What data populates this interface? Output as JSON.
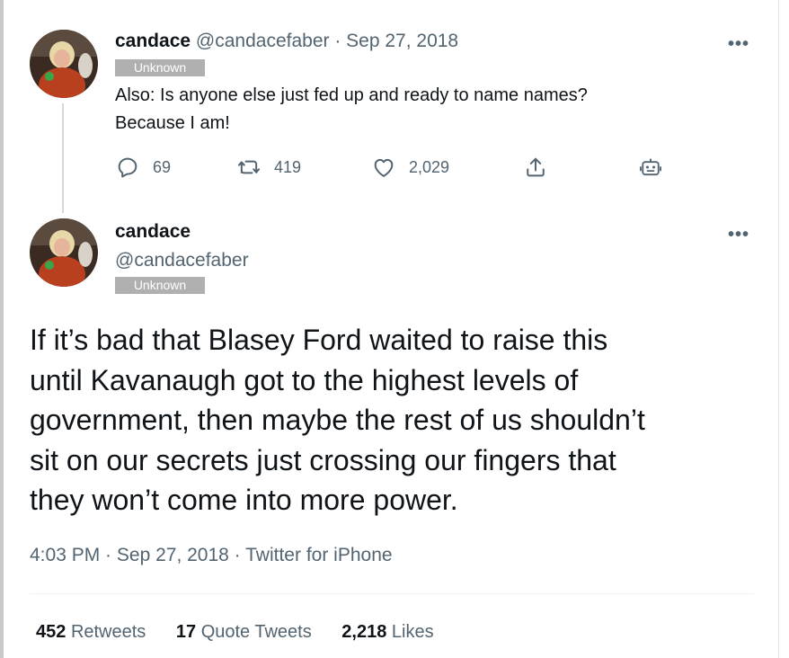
{
  "tweet1": {
    "name": "candace",
    "handle": "@candacefaber",
    "separator": " · ",
    "date": "Sep 27, 2018",
    "badge": "Unknown",
    "text_line1": "Also: Is anyone else just fed up and ready to name names?",
    "text_line2": "Because I am!",
    "more_label": "•••",
    "actions": {
      "reply_count": "69",
      "retweet_count": "419",
      "like_count": "2,029"
    },
    "icons": [
      "reply-icon",
      "retweet-icon",
      "like-icon",
      "share-icon",
      "bot-icon"
    ]
  },
  "tweet2": {
    "name": "candace",
    "handle": "@candacefaber",
    "badge": "Unknown",
    "more_label": "•••",
    "text_lines": [
      "If it’s bad that Blasey Ford waited to raise this",
      "until Kavanaugh got to the highest levels of",
      "government, then maybe the rest of us shouldn’t",
      "sit on our secrets just crossing our fingers that",
      "they won’t come into more power."
    ],
    "time": "4:03 PM",
    "date": "Sep 27, 2018",
    "source": "Twitter for iPhone",
    "meta_sep": " · ",
    "stats": {
      "retweets_count": "452",
      "retweets_label": "Retweets",
      "quotes_count": "17",
      "quotes_label": "Quote Tweets",
      "likes_count": "2,218",
      "likes_label": "Likes"
    }
  },
  "colors": {
    "text": "#0f1419",
    "muted": "#536471",
    "badge_bg": "#b0b0b0",
    "thread_line": "#cfd9de"
  }
}
